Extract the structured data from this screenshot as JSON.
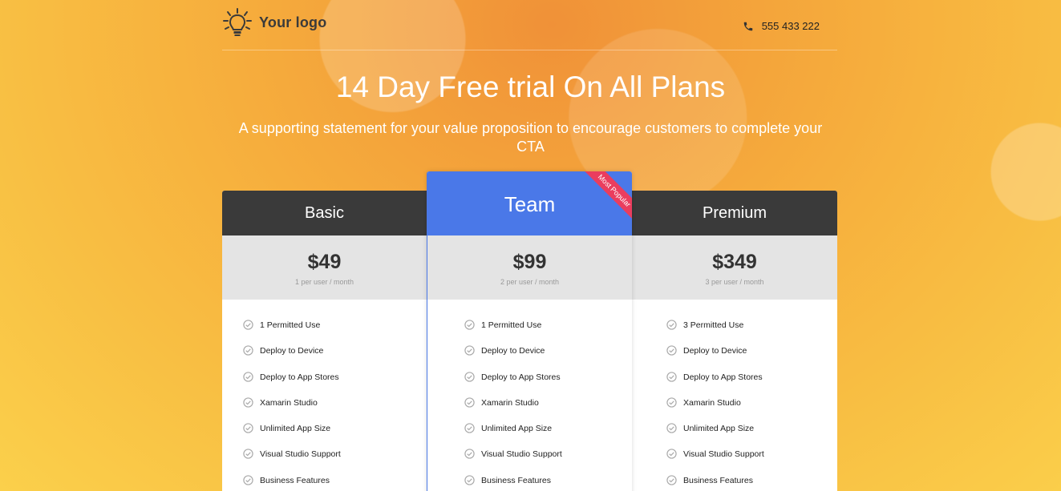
{
  "header": {
    "logo_text": "Your logo",
    "phone": "555 433 222"
  },
  "hero": {
    "title": "14 Day Free trial On All Plans",
    "subtitle": "A supporting statement for your value proposition to encourage customers to complete your CTA"
  },
  "colors": {
    "plan_head_dark": "#3a3a3a",
    "plan_head_featured": "#4a78e8",
    "ribbon": "#ea3d5e",
    "price_box": "#e4e4e4"
  },
  "plans": [
    {
      "name": "Basic",
      "price": "$49",
      "price_note": "1 per user / month",
      "features": [
        "1 Permitted Use",
        "Deploy to Device",
        "Deploy to App Stores",
        "Xamarin Studio",
        "Unlimited App Size",
        "Visual Studio Support",
        "Business Features"
      ]
    },
    {
      "name": "Team",
      "badge": "Most Popular",
      "price": "$99",
      "price_note": "2 per user / month",
      "features": [
        "1 Permitted Use",
        "Deploy to Device",
        "Deploy to App Stores",
        "Xamarin Studio",
        "Unlimited App Size",
        "Visual Studio Support",
        "Business Features"
      ]
    },
    {
      "name": "Premium",
      "price": "$349",
      "price_note": "3 per user / month",
      "features": [
        "3 Permitted Use",
        "Deploy to Device",
        "Deploy to App Stores",
        "Xamarin Studio",
        "Unlimited App Size",
        "Visual Studio Support",
        "Business Features"
      ]
    }
  ],
  "icons": {
    "logo": "lightbulb-icon",
    "phone": "phone-icon",
    "feature": "check-circle-icon"
  }
}
